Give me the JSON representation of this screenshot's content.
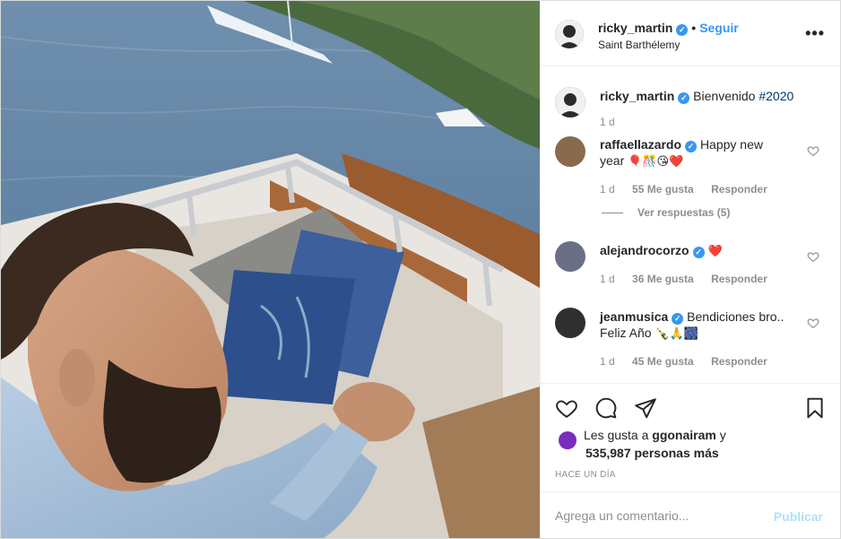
{
  "post": {
    "author": "ricky_martin",
    "follow_label": "Seguir",
    "location": "Saint Barthélemy",
    "more_label": "•••"
  },
  "caption": {
    "username": "ricky_martin",
    "text": "Bienvenido",
    "hashtag": "#2020",
    "age": "1 d"
  },
  "comments": [
    {
      "username": "raffaellazardo",
      "text_line1": "Happy new",
      "text_line2": "year",
      "emoji": "🎈🎊😘❤️",
      "age": "1 d",
      "likes": "55 Me gusta",
      "reply": "Responder",
      "view_replies": "Ver respuestas (5)"
    },
    {
      "username": "alejandrocorzo",
      "emoji": "❤️",
      "age": "1 d",
      "likes": "36 Me gusta",
      "reply": "Responder"
    },
    {
      "username": "jeanmusica",
      "text_line1": "Bendiciones bro..",
      "text_line2": "Feliz Año",
      "emoji": "🍾🙏🎆",
      "age": "1 d",
      "likes": "45 Me gusta",
      "reply": "Responder"
    }
  ],
  "likes": {
    "prefix": "Les gusta a",
    "user": "ggonairam",
    "suffix": "y",
    "count": "535,987 personas más"
  },
  "timestamp": "HACE UN DÍA",
  "add_comment": {
    "placeholder": "Agrega un comentario...",
    "post_label": "Publicar"
  },
  "icons": {
    "like": "heart-icon",
    "comment": "comment-bubble-icon",
    "share": "paper-plane-icon",
    "save": "bookmark-icon",
    "verified": "verified-badge-icon"
  },
  "colors": {
    "accent": "#3897f0",
    "publish_disabled": "#b2dffc",
    "muted": "#8e8e8e"
  }
}
